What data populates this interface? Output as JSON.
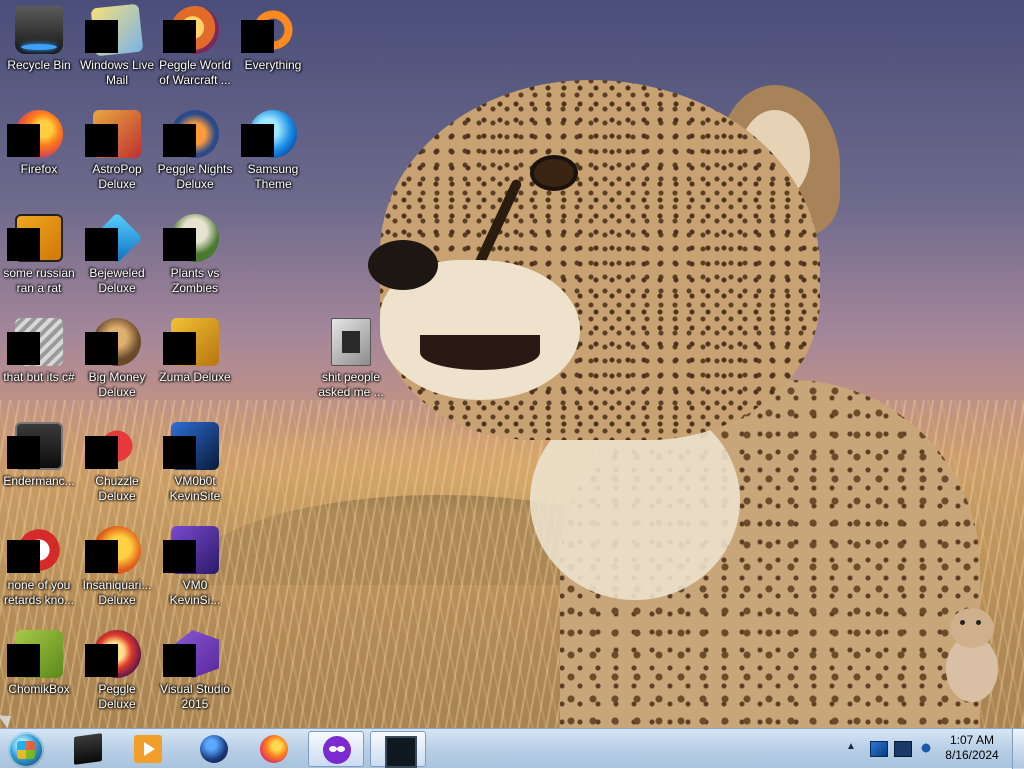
{
  "desktop": {
    "icons": [
      {
        "label": "Recycle Bin",
        "icon": "recycle-bin-icon",
        "redacted": false
      },
      {
        "label": "Windows Live\nMail",
        "icon": "windows-live-mail-icon",
        "redacted": true
      },
      {
        "label": "Peggle World\nof Warcraft ...",
        "icon": "peggle-wow-icon",
        "redacted": true
      },
      {
        "label": "Everything",
        "icon": "everything-search-icon",
        "redacted": true
      },
      {
        "label": "Firefox",
        "icon": "firefox-icon",
        "redacted": true
      },
      {
        "label": "AstroPop\nDeluxe",
        "icon": "astropop-icon",
        "redacted": true
      },
      {
        "label": "Peggle Nights\nDeluxe",
        "icon": "peggle-nights-icon",
        "redacted": true
      },
      {
        "label": "Samsung\nTheme",
        "icon": "samsung-theme-icon",
        "redacted": true
      },
      {
        "label": "some russian\nran a rat",
        "icon": "rat-icon",
        "redacted": true
      },
      {
        "label": "Bejeweled\nDeluxe",
        "icon": "bejeweled-icon",
        "redacted": true
      },
      {
        "label": "Plants vs\nZombies",
        "icon": "plants-vs-zombies-icon",
        "redacted": true
      },
      {
        "label": "that but its c#",
        "icon": "csharp-rat-icon",
        "redacted": true
      },
      {
        "label": "Big Money\nDeluxe",
        "icon": "big-money-icon",
        "redacted": true
      },
      {
        "label": "Zuma Deluxe",
        "icon": "zuma-icon",
        "redacted": true
      },
      {
        "label": "shit people\nasked me ...",
        "icon": "folder-icon",
        "redacted": false
      },
      {
        "label": "Endermanc...",
        "icon": "endermanch-icon",
        "redacted": true
      },
      {
        "label": "Chuzzle\nDeluxe",
        "icon": "chuzzle-icon",
        "redacted": true
      },
      {
        "label": "VM0b0t\nKevinSite",
        "icon": "vm0b0t-icon",
        "redacted": true
      },
      {
        "label": "none of you\nretards kno...",
        "icon": "gsrat-icon",
        "redacted": true
      },
      {
        "label": "Insaniquari...\nDeluxe",
        "icon": "insaniquarium-icon",
        "redacted": true
      },
      {
        "label": "VM0\nKevinSi...",
        "icon": "vm0-icon",
        "redacted": true
      },
      {
        "label": "ChomikBox",
        "icon": "chomikbox-icon",
        "redacted": true
      },
      {
        "label": "Peggle Deluxe",
        "icon": "peggle-deluxe-icon",
        "redacted": true
      },
      {
        "label": "Visual Studio\n2015",
        "icon": "visual-studio-icon",
        "redacted": true
      }
    ]
  },
  "taskbar": {
    "buttons": [
      {
        "name": "start-button",
        "icon": "windows-orb-icon"
      },
      {
        "name": "virtualbox-taskbar-button",
        "icon": "black-box-icon"
      },
      {
        "name": "media-player-taskbar-button",
        "icon": "media-player-icon"
      },
      {
        "name": "globe-taskbar-button",
        "icon": "globe-icon"
      },
      {
        "name": "firefox-taskbar-button",
        "icon": "firefox-icon"
      },
      {
        "name": "mask-app-taskbar-button",
        "icon": "mask-icon",
        "active": true
      },
      {
        "name": "screen-app-taskbar-button",
        "icon": "screen-icon",
        "active": true
      }
    ],
    "tray": {
      "show_hidden_glyph": "▲",
      "time": "1:07 AM",
      "date": "8/16/2024"
    }
  },
  "colors": {
    "taskbar_top": "#d7e6f5",
    "taskbar_bottom": "#a9c3de",
    "label_text": "#ffffff"
  }
}
